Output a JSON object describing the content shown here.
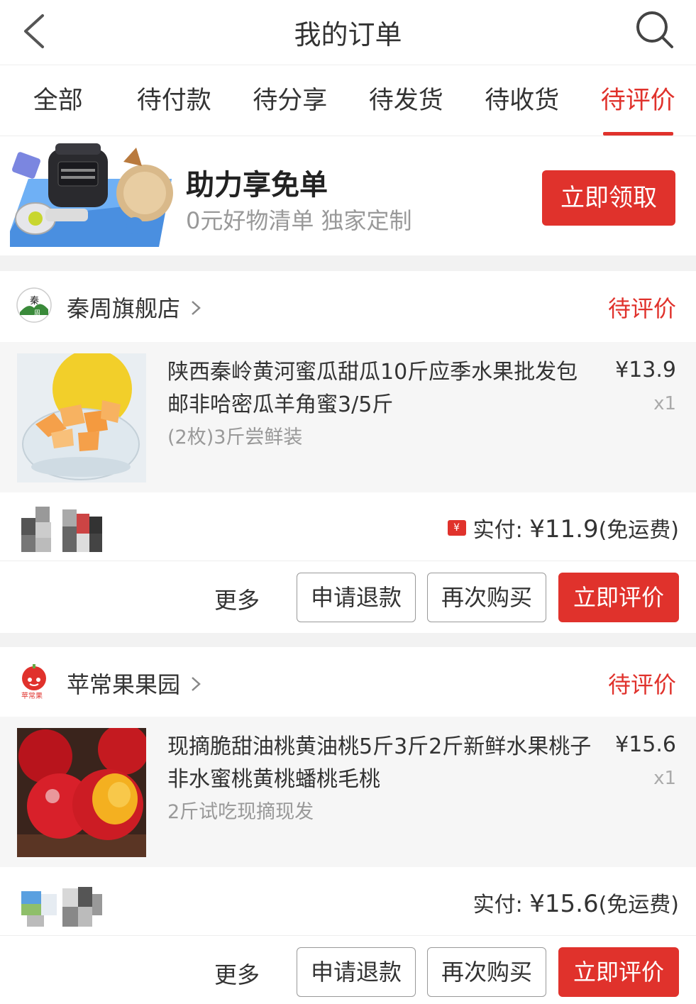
{
  "header": {
    "title": "我的订单",
    "back_icon": "chevron-left-icon",
    "search_icon": "search-icon"
  },
  "tabs": [
    {
      "label": "全部",
      "active": false
    },
    {
      "label": "待付款",
      "active": false
    },
    {
      "label": "待分享",
      "active": false
    },
    {
      "label": "待发货",
      "active": false
    },
    {
      "label": "待收货",
      "active": false
    },
    {
      "label": "待评价",
      "active": true
    }
  ],
  "promo": {
    "title": "助力享免单",
    "subtitle": "0元好物清单 独家定制",
    "button": "立即领取"
  },
  "orders": [
    {
      "shop": "秦周旗舰店",
      "status": "待评价",
      "product": {
        "title": "陕西秦岭黄河蜜瓜甜瓜10斤应季水果批发包邮非哈密瓜羊角蜜3/5斤",
        "spec": "(2枚)3斤尝鲜装",
        "price": "¥13.9",
        "qty": "x1"
      },
      "paid_label": "实付: ",
      "paid_amount": "¥11.9",
      "paid_note": "(免运费)",
      "has_coupon": true,
      "actions": {
        "more": "更多",
        "refund": "申请退款",
        "rebuy": "再次购买",
        "review": "立即评价"
      }
    },
    {
      "shop": "苹常果果园",
      "status": "待评价",
      "product": {
        "title": "现摘脆甜油桃黄油桃5斤3斤2斤新鲜水果桃子非水蜜桃黄桃蟠桃毛桃",
        "spec": "2斤试吃现摘现发",
        "price": "¥15.6",
        "qty": "x1"
      },
      "paid_label": "实付: ",
      "paid_amount": "¥15.6",
      "paid_note": "(免运费)",
      "has_coupon": false,
      "actions": {
        "more": "更多",
        "refund": "申请退款",
        "rebuy": "再次购买",
        "review": "立即评价"
      }
    }
  ],
  "colors": {
    "accent": "#e0322c",
    "muted": "#999999",
    "background": "#f2f2f2"
  }
}
